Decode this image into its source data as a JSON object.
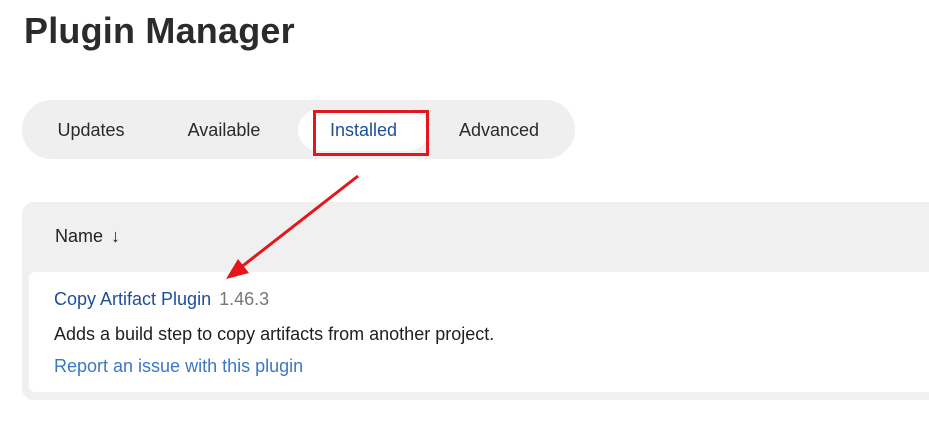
{
  "page": {
    "title": "Plugin Manager"
  },
  "tabs": [
    {
      "label": "Updates",
      "active": false
    },
    {
      "label": "Available",
      "active": false
    },
    {
      "label": "Installed",
      "active": true
    },
    {
      "label": "Advanced",
      "active": false
    }
  ],
  "table": {
    "column_name": "Name",
    "sort_icon": "↓",
    "rows": [
      {
        "name": "Copy Artifact Plugin",
        "version": "1.46.3",
        "description": "Adds a build step to copy artifacts from another project.",
        "report_link": "Report an issue with this plugin"
      }
    ]
  },
  "annotation": {
    "color": "#e3161c",
    "shapes": [
      "highlight-box",
      "arrow"
    ]
  },
  "colors": {
    "link": "#1d4e9a",
    "secondary_link": "#3b78c4",
    "tab_bar": "#efefef"
  }
}
